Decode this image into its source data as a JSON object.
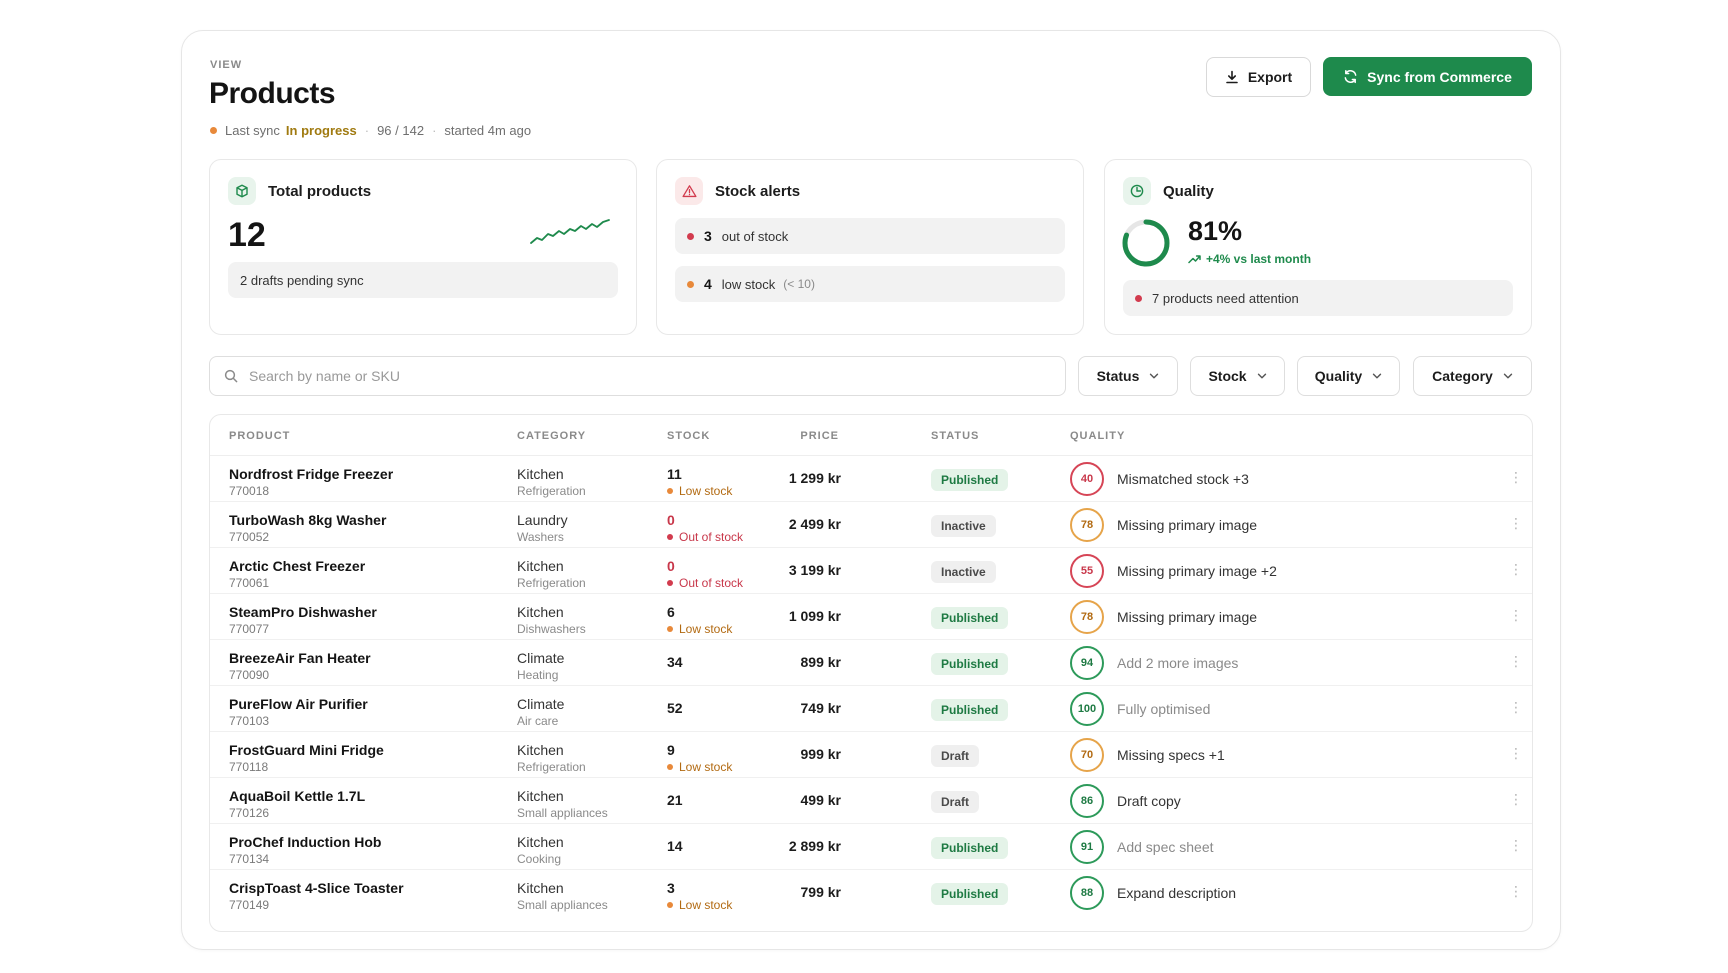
{
  "header": {
    "eyebrow": "VIEW",
    "title": "Products",
    "sync": {
      "label": "Last sync",
      "status": "In progress",
      "count": "96 / 142",
      "started": "started 4m ago"
    },
    "export_label": "Export",
    "sync_button_label": "Sync from Commerce"
  },
  "cards": {
    "total": {
      "title": "Total products",
      "value": "12",
      "note": "2 drafts pending sync"
    },
    "alerts": {
      "title": "Stock alerts",
      "out": {
        "count": "3",
        "label": "out of stock"
      },
      "low": {
        "count": "4",
        "label": "low stock",
        "hint": "(< 10)"
      }
    },
    "quality": {
      "title": "Quality",
      "value": "81%",
      "percent": 81,
      "delta": "+4% vs last month",
      "note": "7 products need attention"
    }
  },
  "filters": {
    "search_placeholder": "Search by name or SKU",
    "status": "Status",
    "stock": "Stock",
    "quality": "Quality",
    "category": "Category"
  },
  "table": {
    "columns": {
      "product": "PRODUCT",
      "category": "CATEGORY",
      "stock": "STOCK",
      "price": "PRICE",
      "status": "STATUS",
      "quality": "QUALITY"
    },
    "rows": [
      {
        "name": "Nordfrost Fridge Freezer",
        "sku": "770018",
        "category": "Kitchen",
        "subcategory": "Refrigeration",
        "stock": "11",
        "stock_note": "Low stock",
        "stock_level": "low",
        "price": "1 299 kr",
        "status": "Published",
        "status_kind": "published",
        "score": "40",
        "score_level": "red",
        "quality_note": "Mismatched stock +3",
        "quality_soft": false
      },
      {
        "name": "TurboWash 8kg Washer",
        "sku": "770052",
        "category": "Laundry",
        "subcategory": "Washers",
        "stock": "0",
        "stock_note": "Out of stock",
        "stock_level": "out",
        "price": "2 499 kr",
        "status": "Inactive",
        "status_kind": "inactive",
        "score": "78",
        "score_level": "amber",
        "quality_note": "Missing primary image",
        "quality_soft": false
      },
      {
        "name": "Arctic Chest Freezer",
        "sku": "770061",
        "category": "Kitchen",
        "subcategory": "Refrigeration",
        "stock": "0",
        "stock_note": "Out of stock",
        "stock_level": "out",
        "price": "3 199 kr",
        "status": "Inactive",
        "status_kind": "inactive",
        "score": "55",
        "score_level": "red",
        "quality_note": "Missing primary image +2",
        "quality_soft": false
      },
      {
        "name": "SteamPro Dishwasher",
        "sku": "770077",
        "category": "Kitchen",
        "subcategory": "Dishwashers",
        "stock": "6",
        "stock_note": "Low stock",
        "stock_level": "low",
        "price": "1 099 kr",
        "status": "Published",
        "status_kind": "published",
        "score": "78",
        "score_level": "amber",
        "quality_note": "Missing primary image",
        "quality_soft": false
      },
      {
        "name": "BreezeAir Fan Heater",
        "sku": "770090",
        "category": "Climate",
        "subcategory": "Heating",
        "stock": "34",
        "stock_note": "",
        "stock_level": "ok",
        "price": "899 kr",
        "status": "Published",
        "status_kind": "published",
        "score": "94",
        "score_level": "green",
        "quality_note": "Add 2 more images",
        "quality_soft": true
      },
      {
        "name": "PureFlow Air Purifier",
        "sku": "770103",
        "category": "Climate",
        "subcategory": "Air care",
        "stock": "52",
        "stock_note": "",
        "stock_level": "ok",
        "price": "749 kr",
        "status": "Published",
        "status_kind": "published",
        "score": "100",
        "score_level": "green",
        "quality_note": "Fully optimised",
        "quality_soft": true
      },
      {
        "name": "FrostGuard Mini Fridge",
        "sku": "770118",
        "category": "Kitchen",
        "subcategory": "Refrigeration",
        "stock": "9",
        "stock_note": "Low stock",
        "stock_level": "low",
        "price": "999 kr",
        "status": "Draft",
        "status_kind": "draft",
        "score": "70",
        "score_level": "amber",
        "quality_note": "Missing specs +1",
        "quality_soft": false
      },
      {
        "name": "AquaBoil Kettle 1.7L",
        "sku": "770126",
        "category": "Kitchen",
        "subcategory": "Small appliances",
        "stock": "21",
        "stock_note": "",
        "stock_level": "ok",
        "price": "499 kr",
        "status": "Draft",
        "status_kind": "draft",
        "score": "86",
        "score_level": "green",
        "quality_note": "Draft copy",
        "quality_soft": false
      },
      {
        "name": "ProChef Induction Hob",
        "sku": "770134",
        "category": "Kitchen",
        "subcategory": "Cooking",
        "stock": "14",
        "stock_note": "",
        "stock_level": "ok",
        "price": "2 899 kr",
        "status": "Published",
        "status_kind": "published",
        "score": "91",
        "score_level": "green",
        "quality_note": "Add spec sheet",
        "quality_soft": true
      },
      {
        "name": "CrispToast 4-Slice Toaster",
        "sku": "770149",
        "category": "Kitchen",
        "subcategory": "Small appliances",
        "stock": "3",
        "stock_note": "Low stock",
        "stock_level": "low",
        "price": "799 kr",
        "status": "Published",
        "status_kind": "published",
        "score": "88",
        "score_level": "green",
        "quality_note": "Expand description",
        "quality_soft": false
      }
    ]
  },
  "colors": {
    "accent": "#1e8a4c",
    "danger": "#d23b4e",
    "warning": "#e8893a"
  },
  "icons": {
    "export": "download-icon",
    "sync": "refresh-icon",
    "total": "cube-icon",
    "alerts": "warning-triangle-icon",
    "quality": "pie-clock-icon",
    "search": "search-icon",
    "chevron": "chevron-down-icon",
    "row_menu": "kebab-menu-icon"
  }
}
